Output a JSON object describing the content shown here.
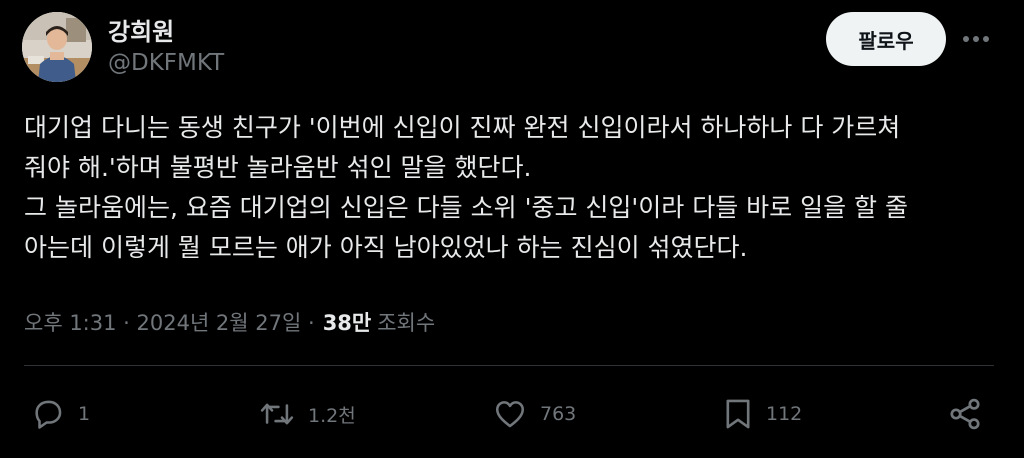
{
  "author": {
    "display_name": "강희원",
    "handle": "@DKFMKT",
    "avatar_icon": "avatar-photo"
  },
  "follow_label": "팔로우",
  "more_icon": "more-horizontal-icon",
  "tweet": {
    "lines": [
      "대기업 다니는 동생 친구가 '이번에 신입이 진짜 완전 신입이라서 하나하나 다 가르쳐",
      "줘야 해.'하며 불평반 놀라움반 섞인 말을 했단다.",
      "그 놀라움에는, 요즘 대기업의 신입은 다들 소위 '중고 신입'이라 다들 바로 일을 할 줄",
      "아는데 이렇게 뭘 모르는 애가 아직 남아있었나 하는 진심이 섞였단다."
    ]
  },
  "meta": {
    "timestamp": "오후 1:31 · 2024년 2월 27일 ·",
    "views_count": "38만",
    "views_label": "조회수"
  },
  "actions": {
    "reply": {
      "icon": "reply-icon",
      "count": "1"
    },
    "retweet": {
      "icon": "retweet-icon",
      "count": "1.2천"
    },
    "like": {
      "icon": "heart-icon",
      "count": "763"
    },
    "bookmark": {
      "icon": "bookmark-icon",
      "count": "112"
    },
    "share": {
      "icon": "share-icon"
    }
  },
  "colors": {
    "background": "#000000",
    "text": "#e7e9ea",
    "secondary": "#71767b",
    "follow_bg": "#eff3f4",
    "divider": "#2f3336"
  }
}
